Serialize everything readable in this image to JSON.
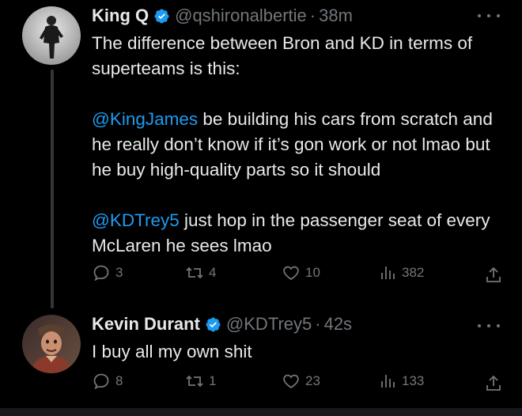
{
  "tweets": [
    {
      "author_name": "King Q",
      "author_handle": "@qshironalbertie",
      "separator": "·",
      "time": "38m",
      "text": {
        "line1": "The difference between Bron and KD in terms of superteams is this:",
        "p2_mention": "@KingJames",
        "p2_rest": " be building his cars from scratch and he really don’t know if it’s gon work or not lmao but he buy high-quality parts so it should",
        "p3_mention": "@KDTrey5",
        "p3_rest": " just hop in the passenger seat of every McLaren he sees lmao"
      },
      "stats": {
        "replies": "3",
        "reposts": "4",
        "likes": "10",
        "views": "382"
      }
    },
    {
      "author_name": "Kevin Durant",
      "author_handle": "@KDTrey5",
      "separator": "·",
      "time": "42s",
      "text": {
        "line1": "I buy all my own shit"
      },
      "stats": {
        "replies": "8",
        "reposts": "1",
        "likes": "23",
        "views": "133"
      }
    }
  ],
  "colors": {
    "accent": "#1d9bf0",
    "muted": "#71767b",
    "text": "#e7e9ea",
    "background": "#000000"
  },
  "icons": [
    "verified-badge-icon",
    "more-icon",
    "reply-icon",
    "repost-icon",
    "like-icon",
    "views-icon",
    "share-icon"
  ]
}
